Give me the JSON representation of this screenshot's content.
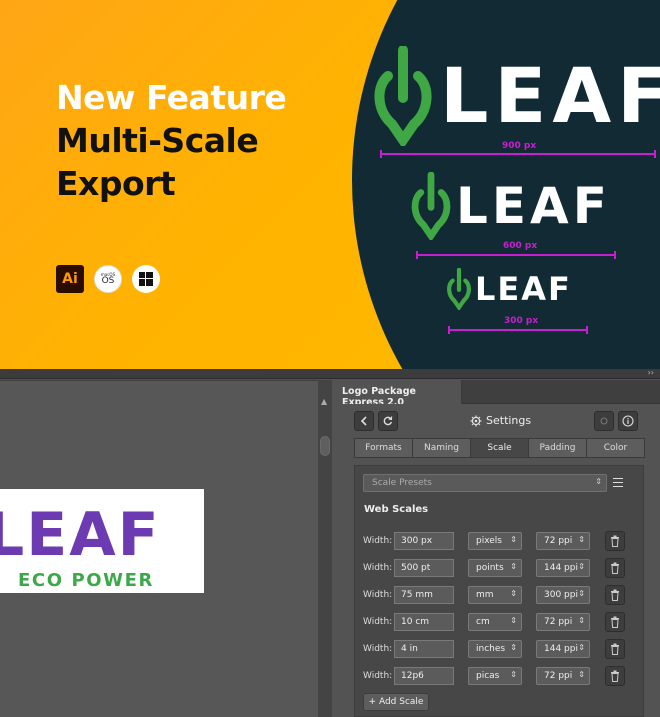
{
  "banner": {
    "headline": [
      "New Feature",
      "Multi-Scale",
      "Export"
    ],
    "platform_icons": [
      "adobe-illustrator-icon",
      "macos-icon",
      "windows-icon"
    ],
    "ai_badge": "Ai",
    "mac_small": "macOS",
    "mac_text": "OS",
    "logos": [
      {
        "word": "LEAF",
        "dimension_label": "900 px"
      },
      {
        "word": "LEAF",
        "dimension_label": "600 px"
      },
      {
        "word": "LEAF",
        "dimension_label": "300 px"
      }
    ],
    "colors": {
      "orange": "#ffad10",
      "dark": "#122a33",
      "leaf_green": "#3fa844",
      "dimension": "#c81ed1"
    }
  },
  "topstrip": {
    "collapse": "››"
  },
  "canvas": {
    "artboard": {
      "word": "LEAF",
      "tagline": "ECO POWER",
      "colors": {
        "word": "#6c3bb1",
        "tagline": "#3da84a"
      }
    }
  },
  "panel": {
    "title": "Logo Package Express 2.0",
    "toolbar": {
      "back_icon": "chevron-left-icon",
      "refresh_icon": "refresh-icon",
      "settings_icon": "gear-icon",
      "settings_label": "Settings",
      "disabled_icon": "gear-icon",
      "info_icon": "info-icon"
    },
    "tabs": [
      {
        "label": "Formats",
        "active": false
      },
      {
        "label": "Naming",
        "active": false
      },
      {
        "label": "Scale",
        "active": true
      },
      {
        "label": "Padding",
        "active": false
      },
      {
        "label": "Color",
        "active": false
      }
    ],
    "presets_placeholder": "Scale Presets",
    "section_title": "Web Scales",
    "width_label": "Width:",
    "rows": [
      {
        "width": "300 px",
        "unit": "pixels",
        "ppi": "72 ppi"
      },
      {
        "width": "500 pt",
        "unit": "points",
        "ppi": "144 ppi"
      },
      {
        "width": "75 mm",
        "unit": "mm",
        "ppi": "300 ppi"
      },
      {
        "width": "10 cm",
        "unit": "cm",
        "ppi": "72 ppi"
      },
      {
        "width": "4 in",
        "unit": "inches",
        "ppi": "144 ppi"
      },
      {
        "width": "12p6",
        "unit": "picas",
        "ppi": "72 ppi"
      }
    ],
    "add_scale_label": "+ Add Scale"
  }
}
